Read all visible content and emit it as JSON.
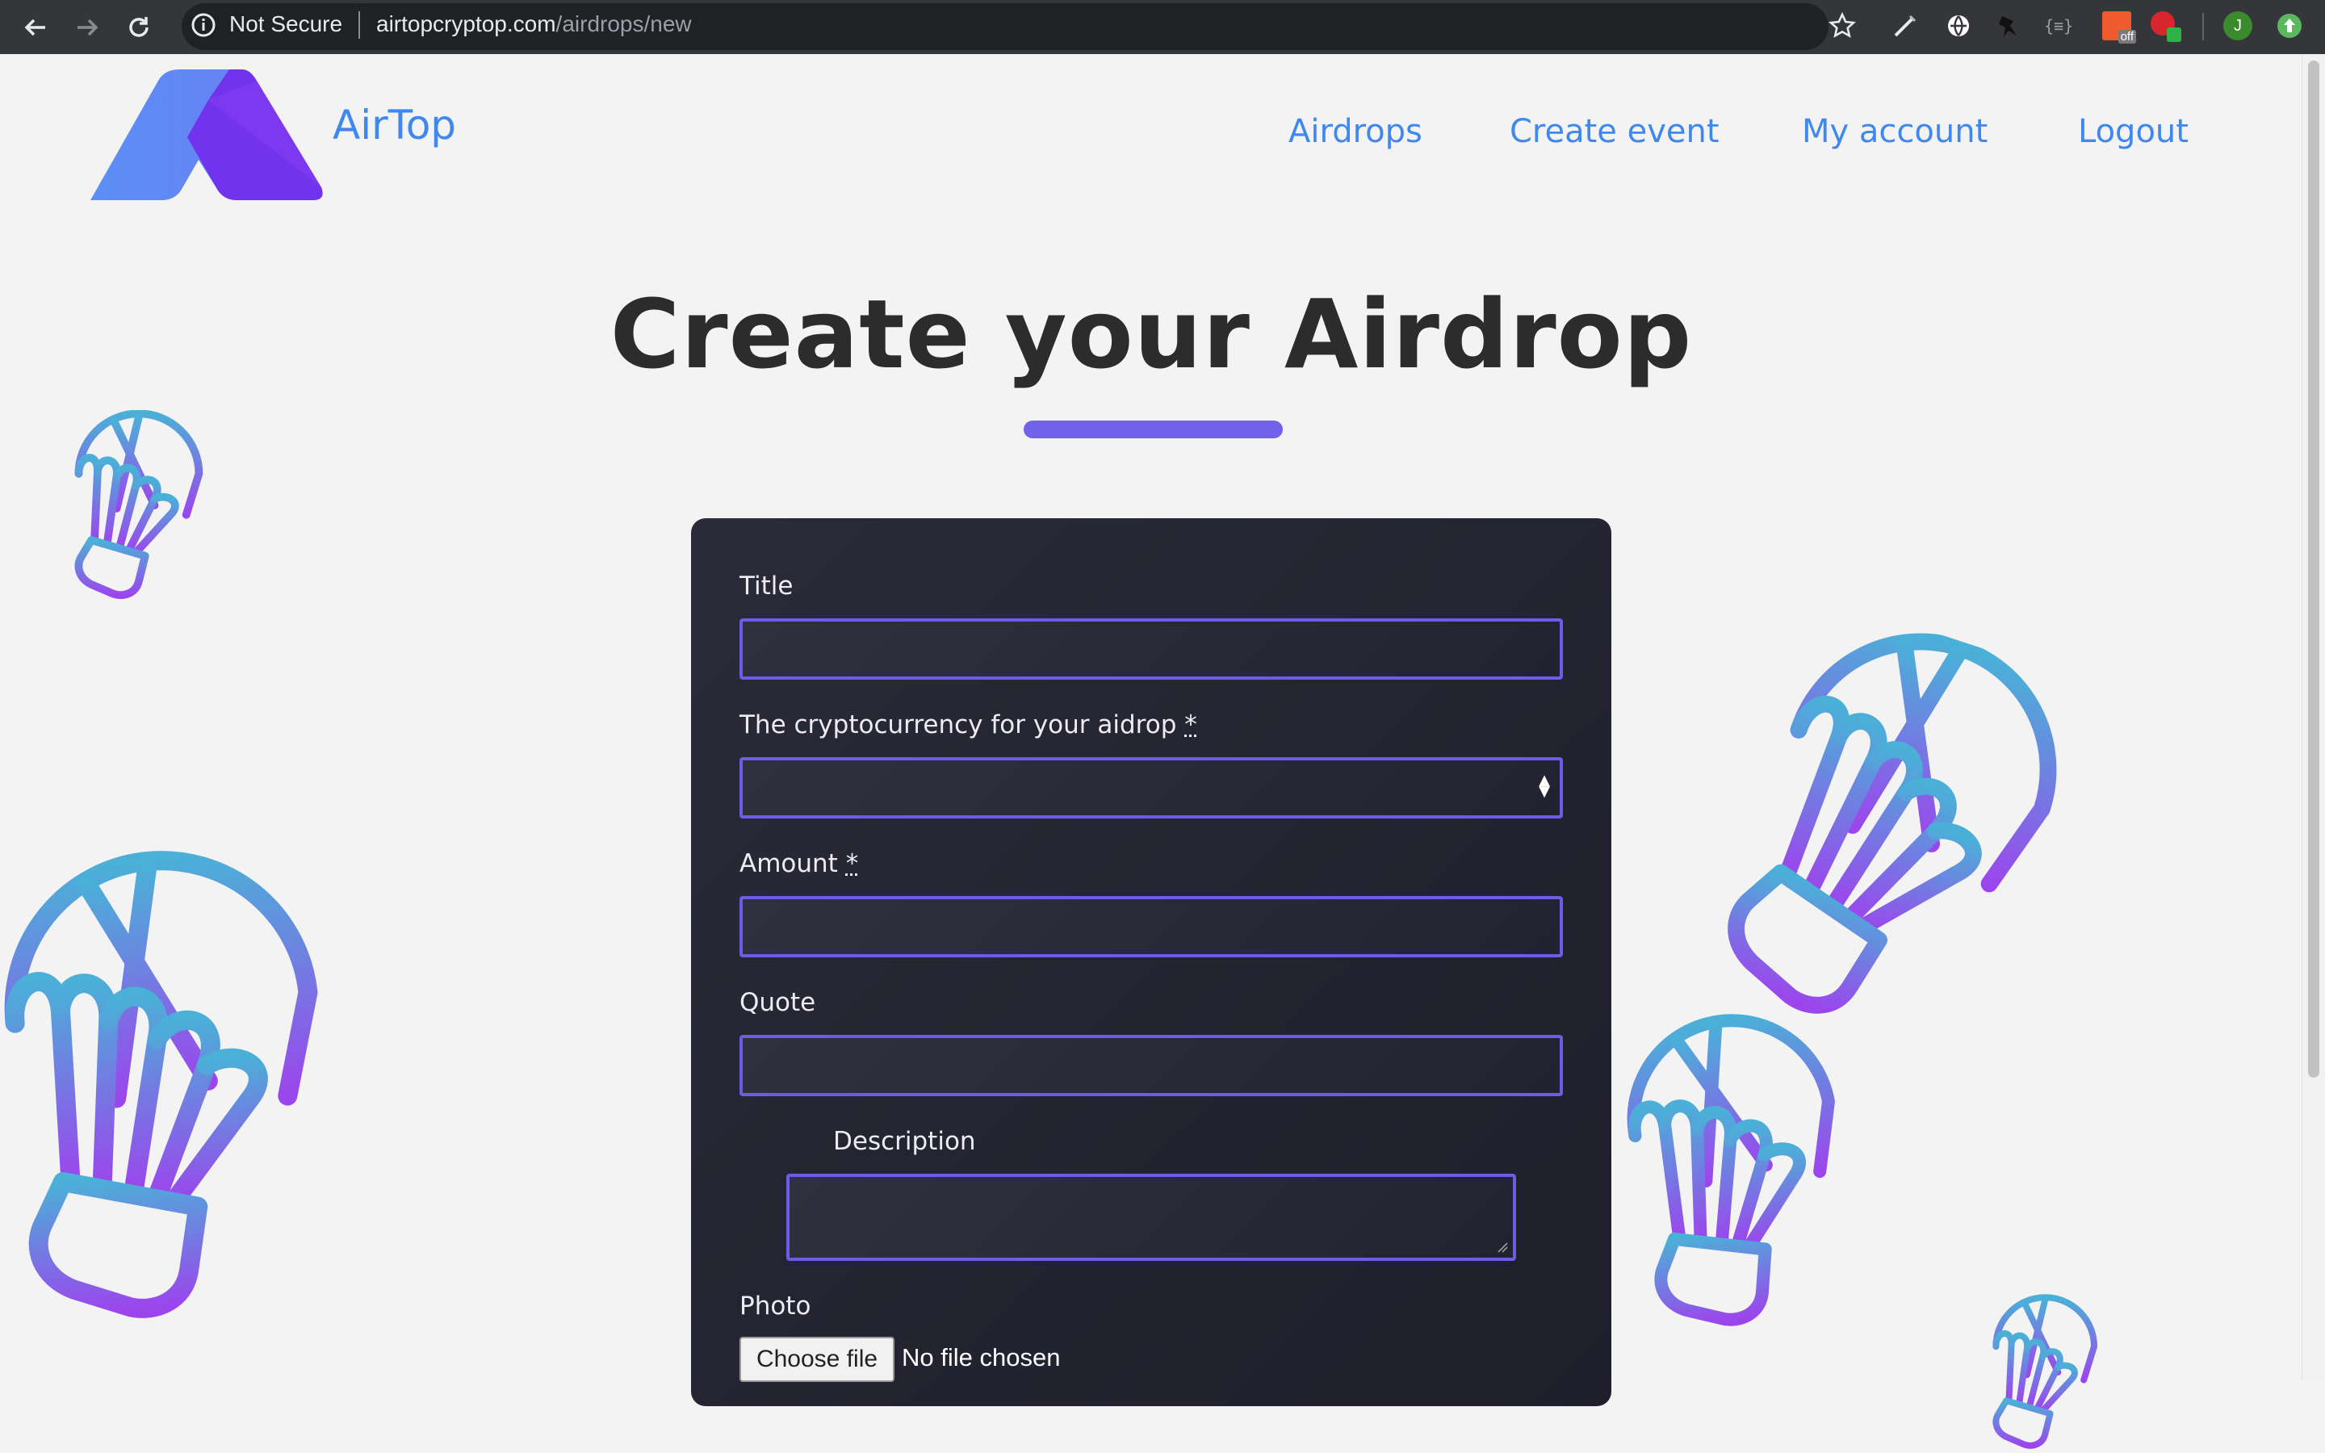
{
  "browser": {
    "security_label": "Not Secure",
    "url_host": "airtopcryptop.com",
    "url_path": "/airdrops/new",
    "profile_initial": "J",
    "ext_badge_off": "off",
    "ext_code_label": "{≡}"
  },
  "header": {
    "brand": "AirTop",
    "nav": {
      "airdrops": "Airdrops",
      "create_event": "Create event",
      "my_account": "My account",
      "logout": "Logout"
    }
  },
  "page": {
    "title": "Create your Airdrop"
  },
  "form": {
    "title_label": "Title",
    "title_value": "",
    "currency_label": "The cryptocurrency for your aidrop",
    "currency_value": "",
    "amount_label": "Amount",
    "amount_value": "",
    "required_marker": "*",
    "quote_label": "Quote",
    "quote_value": "",
    "description_label": "Description",
    "description_value": "",
    "photo_label": "Photo",
    "file_button": "Choose file",
    "file_status": "No file chosen"
  },
  "colors": {
    "brand_blue": "#3f88f0",
    "accent_purple": "#7262ea",
    "card_bg": "#24252f",
    "page_bg": "#f3f3f3"
  }
}
